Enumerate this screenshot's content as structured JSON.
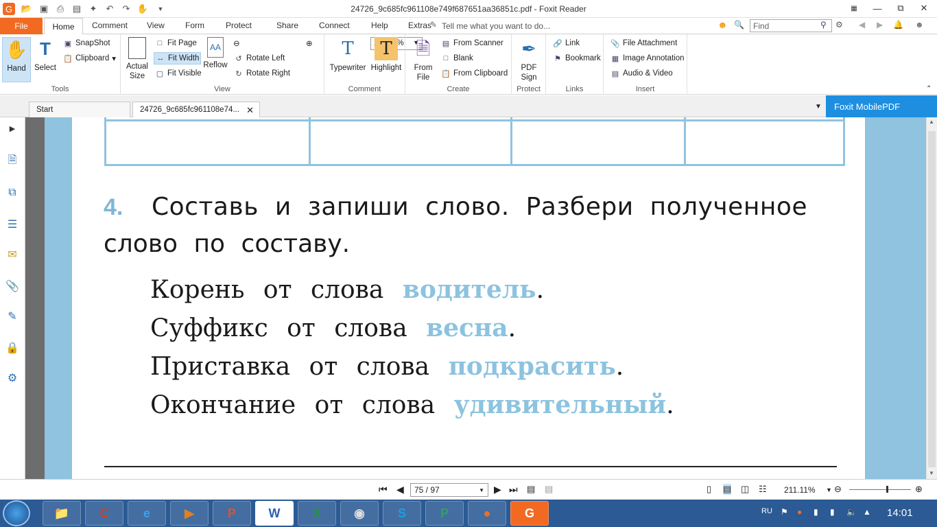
{
  "window": {
    "title": "24726_9c685fc961108e749f687651aa36851c.pdf - Foxit Reader"
  },
  "menu": {
    "file": "File",
    "tabs": [
      "Home",
      "Comment",
      "View",
      "Form",
      "Protect",
      "Share",
      "Connect",
      "Help",
      "Extras"
    ],
    "tell_me": "Tell me what you want to do...",
    "find_placeholder": "Find"
  },
  "ribbon": {
    "tools": {
      "hand": "Hand",
      "select": "Select",
      "snapshot": "SnapShot",
      "clipboard": "Clipboard",
      "label": "Tools"
    },
    "view": {
      "actual_size": "Actual Size",
      "fit_page": "Fit Page",
      "fit_width": "Fit Width",
      "fit_visible": "Fit Visible",
      "reflow": "Reflow",
      "zoom": "211.11%",
      "rotate_left": "Rotate Left",
      "rotate_right": "Rotate Right",
      "label": "View"
    },
    "comment": {
      "typewriter": "Typewriter",
      "highlight": "Highlight",
      "label": "Comment"
    },
    "create": {
      "from_file": "From File",
      "from_scanner": "From Scanner",
      "blank": "Blank",
      "from_clipboard": "From Clipboard",
      "label": "Create"
    },
    "protect": {
      "pdf_sign": "PDF Sign",
      "label": "Protect"
    },
    "links": {
      "link": "Link",
      "bookmark": "Bookmark",
      "label": "Links"
    },
    "insert": {
      "file_attachment": "File Attachment",
      "image_annotation": "Image Annotation",
      "audio_video": "Audio & Video",
      "label": "Insert"
    }
  },
  "doc_tabs": {
    "start": "Start",
    "current": "24726_9c685fc961108e74...",
    "mobile_pdf": "Foxit MobilePDF"
  },
  "document": {
    "task_number": "4.",
    "task_line1": "Составь  и  запиши  слово.  Разбери  полученное",
    "task_line2": "слово  по  составу.",
    "items": [
      {
        "prefix": "Корень от слова",
        "word": "водитель",
        "end": "."
      },
      {
        "prefix": "Суффикс от слова",
        "word": "весна",
        "end": "."
      },
      {
        "prefix": "Приставка от слова",
        "word": "подкрасить",
        "end": "."
      },
      {
        "prefix": "Окончание от слова",
        "word": "удивительный",
        "end": "."
      }
    ]
  },
  "status": {
    "page": "75 / 97",
    "zoom": "211.11%"
  },
  "taskbar": {
    "language": "RU",
    "clock": "14:01"
  }
}
